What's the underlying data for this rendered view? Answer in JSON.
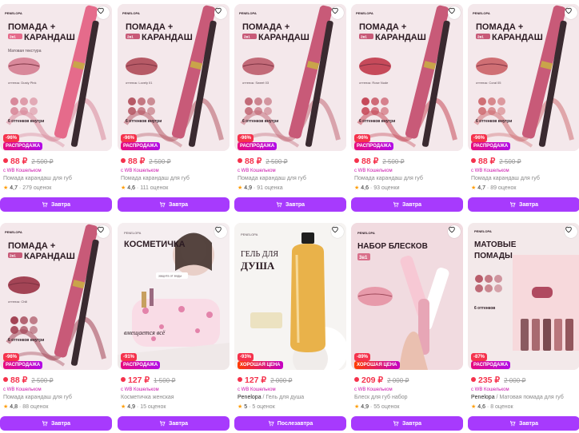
{
  "products": [
    {
      "price": "88 ₽",
      "old_price": "2 500 ₽",
      "wallet": "с WB Кошельком",
      "brand": "",
      "name": "Помада карандаш для губ",
      "rating": "4,7",
      "reviews": "279 оценок",
      "discount": "-96%",
      "promo": "РАСПРОДАЖА",
      "button": "Завтра",
      "img_title": "ПОМАДА +",
      "img_subtitle": "КАРАНДАШ",
      "img_tag": "2в1",
      "img_note": "Матовая текстура",
      "img_shade": "оттенок: Dusty Pink",
      "img_shade_count": "6 оттенков внутри",
      "lip_color": "#d8889a",
      "accent": "#e56b8b"
    },
    {
      "price": "88 ₽",
      "old_price": "2 500 ₽",
      "wallet": "с WB Кошельком",
      "brand": "",
      "name": "Помада карандаш для губ",
      "rating": "4,6",
      "reviews": "111 оценок",
      "discount": "-96%",
      "promo": "РАСПРОДАЖА",
      "button": "Завтра",
      "img_title": "ПОМАДА +",
      "img_subtitle": "КАРАНДАШ",
      "img_tag": "2в1",
      "img_note": "",
      "img_shade": "оттенок: Lovely 01",
      "img_shade_count": "6 оттенков внутри",
      "lip_color": "#b65a66",
      "accent": "#c85a78"
    },
    {
      "price": "88 ₽",
      "old_price": "2 500 ₽",
      "wallet": "с WB Кошельком",
      "brand": "",
      "name": "Помада карандаш для губ",
      "rating": "4,9",
      "reviews": "91 оценка",
      "discount": "-96%",
      "promo": "РАСПРОДАЖА",
      "button": "Завтра",
      "img_title": "ПОМАДА +",
      "img_subtitle": "КАРАНДАШ",
      "img_tag": "2в1",
      "img_note": "",
      "img_shade": "оттенок: Sweet 03",
      "img_shade_count": "6 оттенков внутри",
      "lip_color": "#c26a78",
      "accent": "#c85a78"
    },
    {
      "price": "88 ₽",
      "old_price": "2 500 ₽",
      "wallet": "с WB Кошельком",
      "brand": "",
      "name": "Помада карандаш для губ",
      "rating": "4,6",
      "reviews": "93 оценки",
      "discount": "-96%",
      "promo": "РАСПРОДАЖА",
      "button": "Завтра",
      "img_title": "ПОМАДА +",
      "img_subtitle": "КАРАНДАШ",
      "img_tag": "2в1",
      "img_note": "",
      "img_shade": "оттенок: Rose Nude",
      "img_shade_count": "6 оттенков внутри",
      "lip_color": "#c64a5a",
      "accent": "#c85a78"
    },
    {
      "price": "88 ₽",
      "old_price": "2 500 ₽",
      "wallet": "с WB Кошельком",
      "brand": "",
      "name": "Помада карандаш для губ",
      "rating": "4,7",
      "reviews": "89 оценок",
      "discount": "-96%",
      "promo": "РАСПРОДАЖА",
      "button": "Завтра",
      "img_title": "ПОМАДА +",
      "img_subtitle": "КАРАНДАШ",
      "img_tag": "2в1",
      "img_note": "",
      "img_shade": "оттенок: Coral 05",
      "img_shade_count": "6 оттенков внутри",
      "lip_color": "#cf6f74",
      "accent": "#c85a78"
    },
    {
      "price": "88 ₽",
      "old_price": "2 500 ₽",
      "wallet": "с WB Кошельком",
      "brand": "",
      "name": "Помада карандаш для губ",
      "rating": "4,8",
      "reviews": "88 оценок",
      "discount": "-96%",
      "promo": "РАСПРОДАЖА",
      "button": "Завтра",
      "img_title": "ПОМАДА +",
      "img_subtitle": "КАРАНДАШ",
      "img_tag": "2в1",
      "img_note": "",
      "img_shade": "оттенок: Chili",
      "img_shade_count": "6 оттенков внутри",
      "lip_color": "#a34455",
      "accent": "#c85a78"
    },
    {
      "price": "127 ₽",
      "old_price": "1 500 ₽",
      "wallet": "с WB Кошельком",
      "brand": "",
      "name": "Косметичка женская",
      "rating": "4,9",
      "reviews": "15 оценок",
      "discount": "-91%",
      "promo": "РАСПРОДАЖА",
      "button": "Завтра",
      "img_title": "КОСМЕТИЧКА",
      "img_subtitle": "вмещается всё",
      "img_tag": "",
      "img_note": "защита от воды",
      "img_shade": "",
      "img_shade_count": "",
      "lip_color": "#e8a0b4",
      "accent": "#d23c7a"
    },
    {
      "price": "127 ₽",
      "old_price": "2 000 ₽",
      "wallet": "с WB Кошельком",
      "brand": "Penelopa",
      "name": "Гель для душа",
      "rating": "5",
      "reviews": "5 оценок",
      "discount": "-93%",
      "promo": "ХОРОШАЯ ЦЕНА",
      "button": "Послезавтра",
      "img_title": "ГЕЛЬ ДЛЯ",
      "img_subtitle": "ДУША",
      "img_tag": "",
      "img_note": "",
      "img_shade": "",
      "img_shade_count": "",
      "lip_color": "#e9b24a",
      "accent": "#d0901e"
    },
    {
      "price": "209 ₽",
      "old_price": "2 000 ₽",
      "wallet": "с WB Кошельком",
      "brand": "",
      "name": "Блеск для губ набор",
      "rating": "4,9",
      "reviews": "55 оценок",
      "discount": "-89%",
      "promo": "ХОРОШАЯ ЦЕНА",
      "button": "Завтра",
      "img_title": "НАБОР БЛЕСКОВ",
      "img_subtitle": "3в1",
      "img_tag": "",
      "img_note": "",
      "img_shade": "",
      "img_shade_count": "",
      "lip_color": "#e79aaa",
      "accent": "#d96f8a"
    },
    {
      "price": "235 ₽",
      "old_price": "2 000 ₽",
      "wallet": "с WB Кошельком",
      "brand": "Penelopa",
      "name": "Матовая помада для губ",
      "rating": "4,6",
      "reviews": "8 оценок",
      "discount": "-87%",
      "promo": "РАСПРОДАЖА",
      "button": "Завтра",
      "img_title": "МАТОВЫЕ",
      "img_subtitle": "ПОМАДЫ",
      "img_tag": "",
      "img_note": "",
      "img_shade": "",
      "img_shade_count": "6 оттенков",
      "lip_color": "#b85c6a",
      "accent": "#b04a60"
    }
  ],
  "brand_logo": "PENELOPA",
  "icons": {
    "favorite": "heart-icon",
    "cart": "cart-icon",
    "rating": "star-icon"
  },
  "colors": {
    "price": "#f5324c",
    "button": "#a73afd",
    "wallet": "#cb11ab",
    "star": "#ff9c00"
  }
}
